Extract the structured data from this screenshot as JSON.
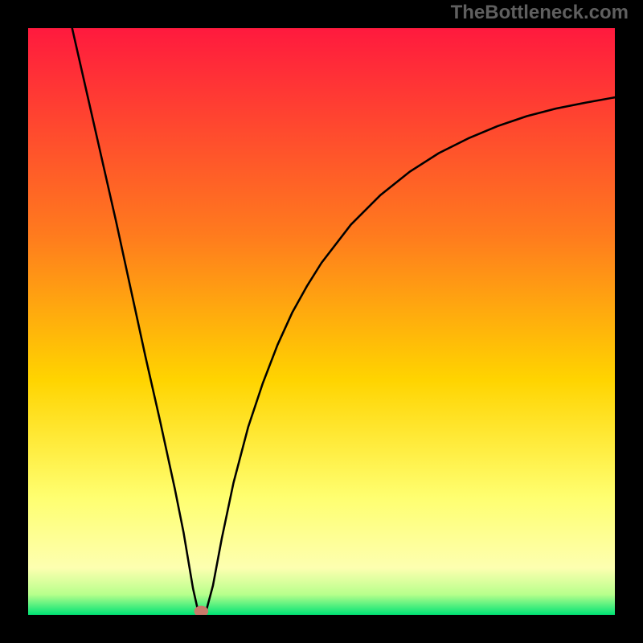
{
  "watermark": "TheBottleneck.com",
  "chart_data": {
    "type": "line",
    "title": "",
    "xlabel": "",
    "ylabel": "",
    "xlim": [
      0,
      100
    ],
    "ylim": [
      0,
      100
    ],
    "grid": false,
    "legend": false,
    "gradient_stops": [
      {
        "offset": 0,
        "color": "#ff1a3e"
      },
      {
        "offset": 35,
        "color": "#ff7a1e"
      },
      {
        "offset": 60,
        "color": "#ffd400"
      },
      {
        "offset": 80,
        "color": "#ffff70"
      },
      {
        "offset": 92,
        "color": "#fdffb0"
      },
      {
        "offset": 96.5,
        "color": "#b8ff8c"
      },
      {
        "offset": 100,
        "color": "#00e375"
      }
    ],
    "curve": {
      "x": [
        7.5,
        10,
        12.5,
        15,
        17.5,
        20,
        22.5,
        25,
        26.5,
        28.1,
        29,
        30.3,
        31.5,
        33,
        35,
        37.5,
        40,
        42.5,
        45,
        47.5,
        50,
        55,
        60,
        65,
        70,
        75,
        80,
        85,
        90,
        95,
        100
      ],
      "y": [
        100,
        89,
        78,
        67,
        55.5,
        44,
        33,
        21.5,
        14,
        4.5,
        0.5,
        0.5,
        5,
        13,
        22.5,
        32,
        39.5,
        46,
        51.5,
        56,
        60,
        66.5,
        71.5,
        75.5,
        78.7,
        81.2,
        83.3,
        85,
        86.3,
        87.3,
        88.2
      ]
    },
    "marker": {
      "x": 29.5,
      "y": 0.6,
      "color": "#c97a6b",
      "r": 1.2
    }
  }
}
